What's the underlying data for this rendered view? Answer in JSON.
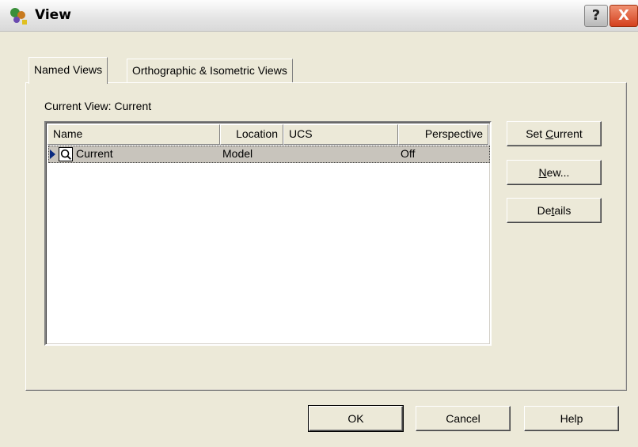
{
  "window": {
    "title": "View",
    "help_button": "?",
    "close_button": "X"
  },
  "tabs": [
    {
      "label": "Named Views",
      "active": true
    },
    {
      "label": "Orthographic & Isometric Views",
      "active": false
    }
  ],
  "current_view": {
    "label": "Current View:",
    "value": "Current"
  },
  "list": {
    "columns": [
      "Name",
      "Location",
      "UCS",
      "Perspective"
    ],
    "rows": [
      {
        "name": "Current",
        "location": "Model",
        "ucs": "",
        "perspective": "Off",
        "selected": true,
        "icon": "view-magnifier-icon"
      }
    ]
  },
  "side_buttons": {
    "set_current": {
      "before": "Set ",
      "mnemonic": "C",
      "after": "urrent"
    },
    "new": {
      "before": "",
      "mnemonic": "N",
      "after": "ew..."
    },
    "details": {
      "before": "De",
      "mnemonic": "t",
      "after": "ails"
    }
  },
  "footer_buttons": {
    "ok": "OK",
    "cancel": "Cancel",
    "help": "Help"
  },
  "colors": {
    "dialog_bg": "#ece9d8",
    "selection": "#c8c4bc",
    "close_red": "#d4401e"
  }
}
